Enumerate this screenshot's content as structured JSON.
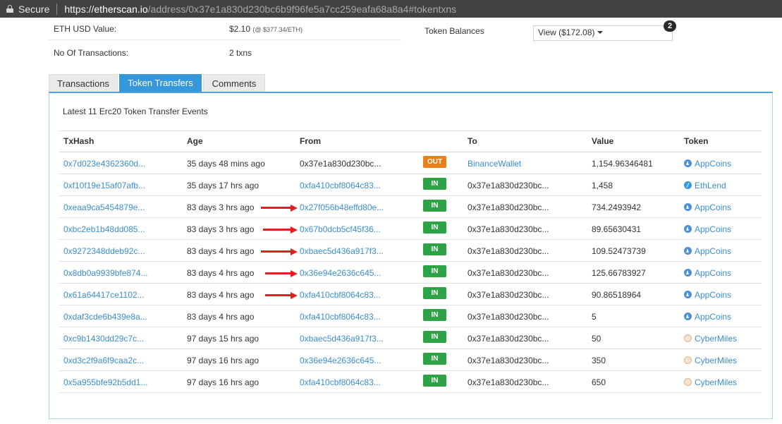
{
  "browser": {
    "secure_label": "Secure",
    "url_scheme": "https://",
    "url_host": "etherscan.io",
    "url_path": "/address/0x37e1a830d230bc6b9f96fe5a7cc259eafa68a8a4#tokentxns"
  },
  "overview": {
    "eth_usd_label": "ETH USD Value:",
    "eth_usd_value": "$2.10",
    "eth_usd_rate": "(@ $377.34/ETH)",
    "tx_count_label": "No Of Transactions:",
    "tx_count_value": "2 txns",
    "token_balances_label": "Token Balances",
    "token_balances_select": "View ($172.08)",
    "token_count": "2"
  },
  "tabs": [
    {
      "label": "Transactions",
      "active": false
    },
    {
      "label": "Token Transfers",
      "active": true
    },
    {
      "label": "Comments",
      "active": false
    }
  ],
  "transfers": {
    "caption": "Latest 11 Erc20 Token Transfer Events",
    "headers": {
      "txhash": "TxHash",
      "age": "Age",
      "from": "From",
      "to": "To",
      "value": "Value",
      "token": "Token"
    },
    "rows": [
      {
        "txhash": "0x7d023e4362360d...",
        "age": "35 days 48 mins ago",
        "from": "0x37e1a830d230bc...",
        "from_link": false,
        "direction": "OUT",
        "to": "BinanceWallet",
        "to_link": true,
        "value": "1,154.96346481",
        "token": "AppCoins",
        "token_icon": "appcoins-icon",
        "arrow": false
      },
      {
        "txhash": "0xf10f19e15af07afb...",
        "age": "35 days 17 hrs ago",
        "from": "0xfa410cbf8064c83...",
        "from_link": true,
        "direction": "IN",
        "to": "0x37e1a830d230bc...",
        "to_link": false,
        "value": "1,458",
        "token": "EthLend",
        "token_icon": "ethlend-icon",
        "arrow": false
      },
      {
        "txhash": "0xeaa9ca5454879e...",
        "age": "83 days 3 hrs ago",
        "from": "0x27f056b48effd80e...",
        "from_link": true,
        "direction": "IN",
        "to": "0x37e1a830d230bc...",
        "to_link": false,
        "value": "734.2493942",
        "token": "AppCoins",
        "token_icon": "appcoins-icon",
        "arrow": true
      },
      {
        "txhash": "0xbc2eb1b48dd085...",
        "age": "83 days 3 hrs ago",
        "from": "0x67b0dcb5cf45f36...",
        "from_link": true,
        "direction": "IN",
        "to": "0x37e1a830d230bc...",
        "to_link": false,
        "value": "89.65630431",
        "token": "AppCoins",
        "token_icon": "appcoins-icon",
        "arrow": true
      },
      {
        "txhash": "0x9272348ddeb92c...",
        "age": "83 days 4 hrs ago",
        "from": "0xbaec5d436a917f3...",
        "from_link": true,
        "direction": "IN",
        "to": "0x37e1a830d230bc...",
        "to_link": false,
        "value": "109.52473739",
        "token": "AppCoins",
        "token_icon": "appcoins-icon",
        "arrow": true
      },
      {
        "txhash": "0x8db0a9939bfe874...",
        "age": "83 days 4 hrs ago",
        "from": "0x36e94e2636c645...",
        "from_link": true,
        "direction": "IN",
        "to": "0x37e1a830d230bc...",
        "to_link": false,
        "value": "125.66783927",
        "token": "AppCoins",
        "token_icon": "appcoins-icon",
        "arrow": true
      },
      {
        "txhash": "0x61a64417ce1102...",
        "age": "83 days 4 hrs ago",
        "from": "0xfa410cbf8064c83...",
        "from_link": true,
        "direction": "IN",
        "to": "0x37e1a830d230bc...",
        "to_link": false,
        "value": "90.86518964",
        "token": "AppCoins",
        "token_icon": "appcoins-icon",
        "arrow": true
      },
      {
        "txhash": "0xdaf3cde6b439e8a...",
        "age": "83 days 4 hrs ago",
        "from": "0xfa410cbf8064c83...",
        "from_link": true,
        "direction": "IN",
        "to": "0x37e1a830d230bc...",
        "to_link": false,
        "value": "5",
        "token": "AppCoins",
        "token_icon": "appcoins-icon",
        "arrow": false
      },
      {
        "txhash": "0xc9b1430dd29c7c...",
        "age": "97 days 15 hrs ago",
        "from": "0xbaec5d436a917f3...",
        "from_link": true,
        "direction": "IN",
        "to": "0x37e1a830d230bc...",
        "to_link": false,
        "value": "50",
        "token": "CyberMiles",
        "token_icon": "cybermiles-icon",
        "arrow": false
      },
      {
        "txhash": "0xd3c2f9a6f9caa2c...",
        "age": "97 days 16 hrs ago",
        "from": "0x36e94e2636c645...",
        "from_link": true,
        "direction": "IN",
        "to": "0x37e1a830d230bc...",
        "to_link": false,
        "value": "350",
        "token": "CyberMiles",
        "token_icon": "cybermiles-icon",
        "arrow": false
      },
      {
        "txhash": "0x5a955bfe92b5dd1...",
        "age": "97 days 16 hrs ago",
        "from": "0xfa410cbf8064c83...",
        "from_link": true,
        "direction": "IN",
        "to": "0x37e1a830d230bc...",
        "to_link": false,
        "value": "650",
        "token": "CyberMiles",
        "token_icon": "cybermiles-icon",
        "arrow": false
      }
    ]
  },
  "colors": {
    "link": "#3a8fd0",
    "tab_active": "#3498db",
    "badge_in": "#2ea345",
    "badge_out": "#e6811c",
    "annotation_arrow": "#e02020"
  }
}
